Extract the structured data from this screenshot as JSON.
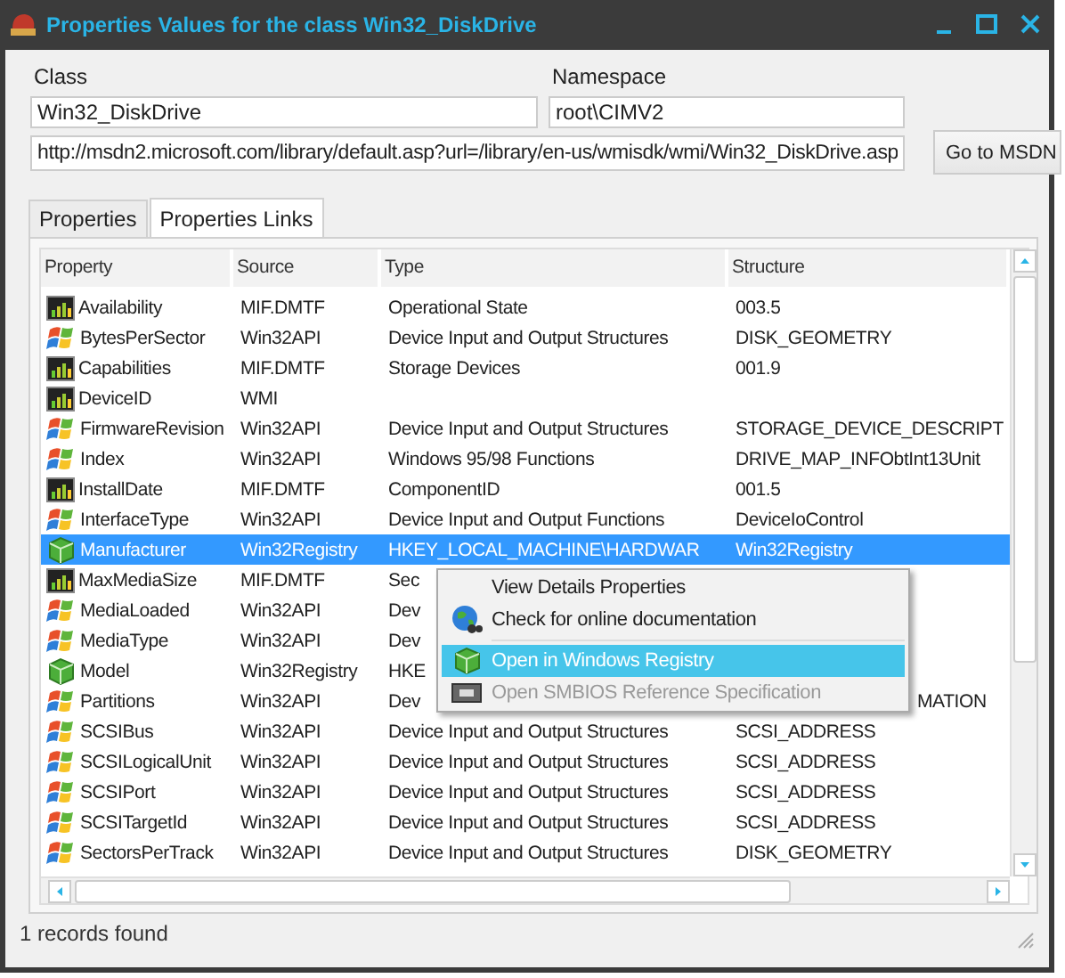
{
  "window": {
    "title": "Properties Values for the class Win32_DiskDrive"
  },
  "class_label": "Class",
  "class_value": "Win32_DiskDrive",
  "namespace_label": "Namespace",
  "namespace_value": "root\\CIMV2",
  "url": "http://msdn2.microsoft.com/library/default.asp?url=/library/en-us/wmisdk/wmi/Win32_DiskDrive.asp",
  "msdn_button": "Go to MSDN",
  "tabs": [
    {
      "label": "Properties",
      "selected": false
    },
    {
      "label": "Properties Links",
      "selected": true
    }
  ],
  "table": {
    "columns": [
      "Property",
      "Source",
      "Type",
      "Structure"
    ],
    "rows": [
      {
        "kind": "chart",
        "property": "Availability",
        "source": "MIF.DMTF",
        "type": "Operational State",
        "structure": "003.5",
        "selected": false
      },
      {
        "kind": "windows",
        "property": "BytesPerSector",
        "source": "Win32API",
        "type": "Device Input and Output Structures",
        "structure": "DISK_GEOMETRY",
        "selected": false
      },
      {
        "kind": "chart",
        "property": "Capabilities",
        "source": "MIF.DMTF",
        "type": "Storage Devices",
        "structure": "001.9",
        "selected": false
      },
      {
        "kind": "chart",
        "property": "DeviceID",
        "source": "WMI",
        "selected": false
      },
      {
        "kind": "windows",
        "property": "FirmwareRevision",
        "source": "Win32API",
        "type": "Device Input and Output Structures",
        "structure": "STORAGE_DEVICE_DESCRIPT",
        "selected": false
      },
      {
        "kind": "windows",
        "property": "Index",
        "source": "Win32API",
        "type": "Windows 95/98 Functions",
        "structure": "DRIVE_MAP_INFObtInt13Unit",
        "selected": false
      },
      {
        "kind": "chart",
        "property": "InstallDate",
        "source": "MIF.DMTF",
        "type": "ComponentID",
        "structure": "001.5",
        "selected": false
      },
      {
        "kind": "windows",
        "property": "InterfaceType",
        "source": "Win32API",
        "type": "Device Input and Output Functions",
        "structure": "DeviceIoControl",
        "selected": false
      },
      {
        "kind": "registry",
        "property": "Manufacturer",
        "source": "Win32Registry",
        "type": "HKEY_LOCAL_MACHINE\\HARDWAR",
        "structure": "Win32Registry",
        "selected": true
      },
      {
        "kind": "chart",
        "property": "MaxMediaSize",
        "source": "MIF.DMTF",
        "type": "Sec",
        "selected": false
      },
      {
        "kind": "windows",
        "property": "MediaLoaded",
        "source": "Win32API",
        "type": "Dev",
        "selected": false
      },
      {
        "kind": "windows",
        "property": "MediaType",
        "source": "Win32API",
        "type": "Dev",
        "selected": false
      },
      {
        "kind": "registry",
        "property": "Model",
        "source": "Win32Registry",
        "type": "HKE",
        "selected": false
      },
      {
        "kind": "windows",
        "property": "Partitions",
        "source": "Win32API",
        "type": "Dev",
        "structure": "MATION",
        "selected": false,
        "covered": true
      },
      {
        "kind": "windows",
        "property": "SCSIBus",
        "source": "Win32API",
        "type": "Device Input and Output Structures",
        "structure": "SCSI_ADDRESS",
        "selected": false
      },
      {
        "kind": "windows",
        "property": "SCSILogicalUnit",
        "source": "Win32API",
        "type": "Device Input and Output Structures",
        "structure": "SCSI_ADDRESS",
        "selected": false
      },
      {
        "kind": "windows",
        "property": "SCSIPort",
        "source": "Win32API",
        "type": "Device Input and Output Structures",
        "structure": "SCSI_ADDRESS",
        "selected": false
      },
      {
        "kind": "windows",
        "property": "SCSITargetId",
        "source": "Win32API",
        "type": "Device Input and Output Structures",
        "structure": "SCSI_ADDRESS",
        "selected": false
      },
      {
        "kind": "windows",
        "property": "SectorsPerTrack",
        "source": "Win32API",
        "type": "Device Input and Output Structures",
        "structure": "DISK_GEOMETRY",
        "selected": false
      }
    ]
  },
  "context_menu": [
    {
      "kind": "item",
      "label": "View Details Properties",
      "selected": false,
      "disabled": false
    },
    {
      "kind": "globe",
      "label": "Check for online documentation",
      "selected": false,
      "disabled": false
    },
    {
      "kind": "separator"
    },
    {
      "kind": "registry",
      "label": "Open in Windows Registry",
      "selected": true,
      "disabled": false
    },
    {
      "kind": "chip",
      "label": "Open SMBIOS Reference Specification",
      "selected": false,
      "disabled": true
    }
  ],
  "status_bar": "1 records found"
}
